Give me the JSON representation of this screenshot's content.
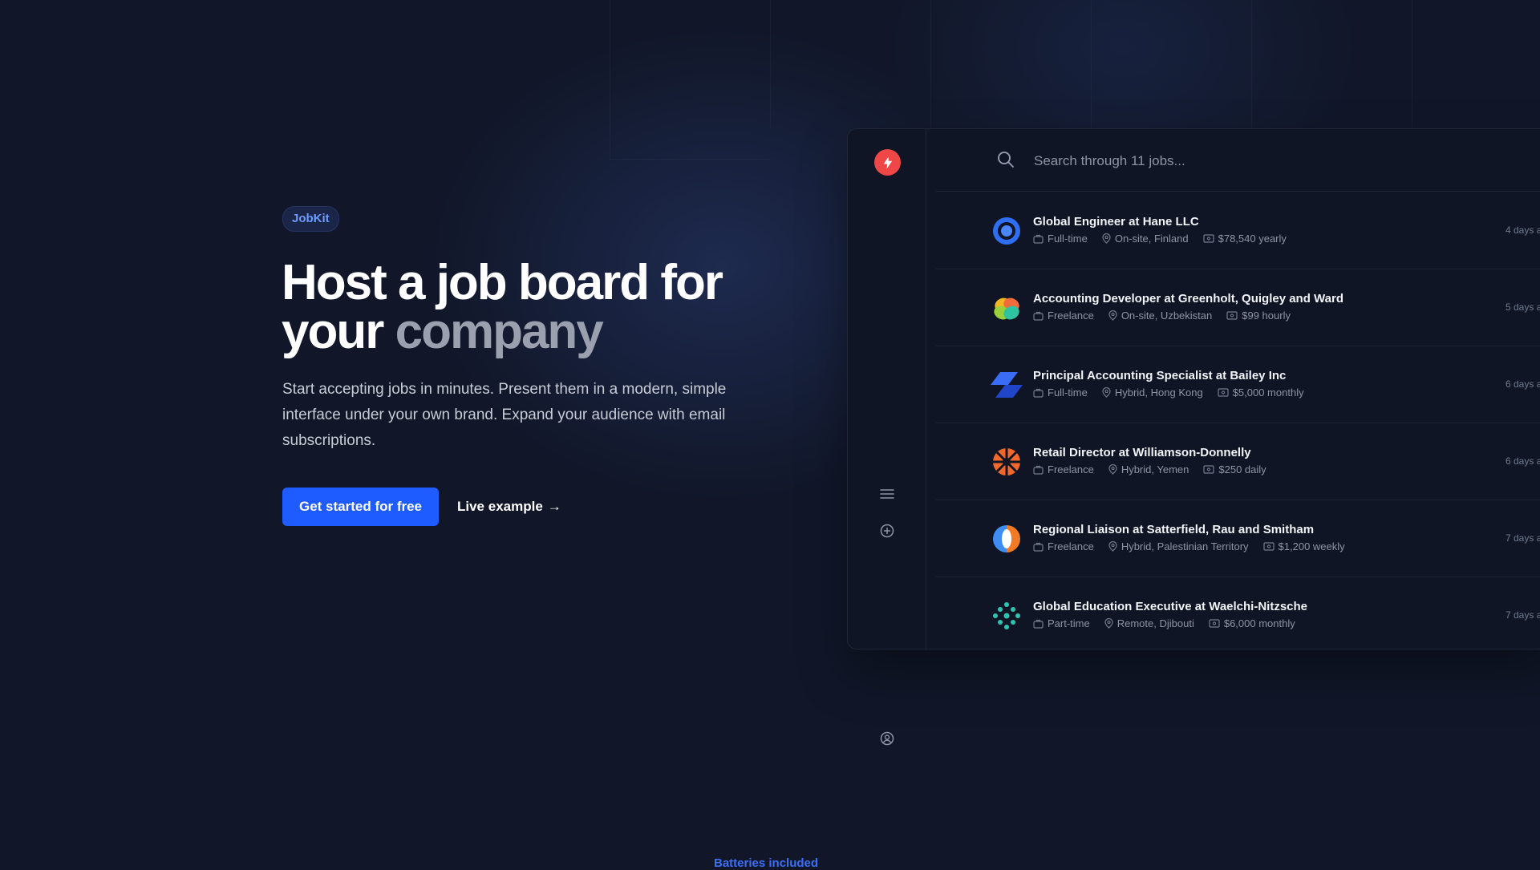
{
  "brand_badge": "JobKit",
  "hero": {
    "headline_main": "Host a job board for your",
    "headline_accent": "company",
    "subtext": "Start accepting jobs in minutes. Present them in a modern, simple interface under your own brand. Expand your audience with email subscriptions.",
    "cta_primary": "Get started for free",
    "cta_secondary": "Live example",
    "cta_secondary_arrow": "→"
  },
  "footer_teaser": "Batteries included",
  "app": {
    "search_placeholder": "Search through 11 jobs...",
    "sidebar_icons": [
      "logo-bolt-icon",
      "menu-icon",
      "add-circle-icon",
      "user-circle-icon"
    ],
    "jobs": [
      {
        "title": "Global Engineer at Hane LLC",
        "type": "Full-time",
        "location": "On-site, Finland",
        "salary": "$78,540 yearly",
        "age": "4 days a",
        "logo": "blue-ring-logo"
      },
      {
        "title": "Accounting Developer at Greenholt, Quigley and Ward",
        "type": "Freelance",
        "location": "On-site, Uzbekistan",
        "salary": "$99 hourly",
        "age": "5 days a",
        "logo": "petal-logo"
      },
      {
        "title": "Principal Accounting Specialist at Bailey Inc",
        "type": "Full-time",
        "location": "Hybrid, Hong Kong",
        "salary": "$5,000 monthly",
        "age": "6 days a",
        "logo": "blue-parallelogram-logo"
      },
      {
        "title": "Retail Director at Williamson-Donnelly",
        "type": "Freelance",
        "location": "Hybrid, Yemen",
        "salary": "$250 daily",
        "age": "6 days a",
        "logo": "orange-grid-logo"
      },
      {
        "title": "Regional Liaison at Satterfield, Rau and Smitham",
        "type": "Freelance",
        "location": "Hybrid, Palestinian Territory",
        "salary": "$1,200 weekly",
        "age": "7 days a",
        "logo": "orange-blue-circle-logo"
      },
      {
        "title": "Global Education Executive at Waelchi-Nitzsche",
        "type": "Part-time",
        "location": "Remote, Djibouti",
        "salary": "$6,000 monthly",
        "age": "7 days a",
        "logo": "teal-dots-logo"
      }
    ]
  },
  "colors": {
    "background": "#111729",
    "accent": "#1f5cff",
    "logo_red": "#ef4747",
    "badge_text": "#6e9bff"
  }
}
